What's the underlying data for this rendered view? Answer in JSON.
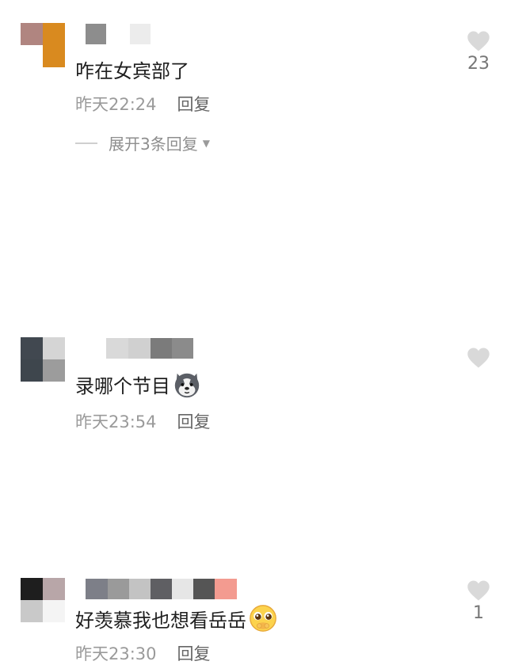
{
  "comments": [
    {
      "text": "咋在女宾部了",
      "time": "昨天22:24",
      "reply_label": "回复",
      "likes": "23",
      "expand_label": "展开3条回复",
      "avatar_colors": [
        "#b08580",
        "#d98a1f",
        "#ffffff",
        "#d98a1f"
      ],
      "username_colors": [
        "#8d8d8d",
        "#ffffff",
        "#ececec"
      ]
    },
    {
      "text": "录哪个节目",
      "emoji": "husky-dog-emoji",
      "time": "昨天23:54",
      "reply_label": "回复",
      "likes": "",
      "avatar_colors": [
        "#414850",
        "#d5d5d5",
        "#3e464d",
        "#9c9c9c"
      ],
      "username_colors": [
        "#d9d9d9",
        "#d0d0d0",
        "#7b7b7b",
        "#8b8b8b"
      ]
    },
    {
      "text": "好羡慕我也想看岳岳",
      "emoji": "pleading-face-emoji",
      "time": "昨天23:30",
      "reply_label": "回复",
      "likes": "1",
      "avatar_colors": [
        "#1e1e1e",
        "#b8a6a8",
        "#c9c9c9",
        "#f4f4f4"
      ],
      "username_colors": [
        "#7d7f88",
        "#9a9a9a",
        "#c3c3c3",
        "#5f5f63",
        "#e6e6e6",
        "#555555",
        "#f39b90"
      ]
    }
  ],
  "icons": {
    "like": "heart-icon",
    "expand": "triangle-down-icon"
  }
}
